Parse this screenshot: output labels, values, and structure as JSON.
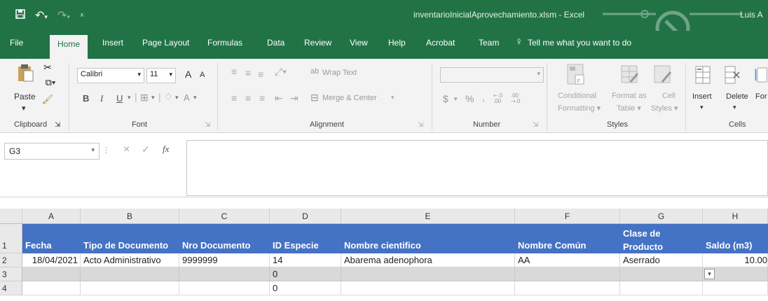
{
  "window": {
    "title": "inventarioInicialAprovechamiento.xlsm  -  Excel",
    "user": "Luis A"
  },
  "tabs": [
    {
      "label": "File"
    },
    {
      "label": "Home"
    },
    {
      "label": "Insert"
    },
    {
      "label": "Page Layout"
    },
    {
      "label": "Formulas"
    },
    {
      "label": "Data"
    },
    {
      "label": "Review"
    },
    {
      "label": "View"
    },
    {
      "label": "Help"
    },
    {
      "label": "Acrobat"
    },
    {
      "label": "Team"
    }
  ],
  "tell_me": "Tell me what you want to do",
  "ribbon": {
    "clipboard": {
      "paste": "Paste",
      "label": "Clipboard"
    },
    "font": {
      "name": "Calibri",
      "size": "11",
      "bold": "B",
      "italic": "I",
      "underline": "U",
      "grow": "A",
      "shrink": "A",
      "color": "A",
      "label": "Font"
    },
    "alignment": {
      "wrap": "Wrap Text",
      "merge": "Merge & Center",
      "label": "Alignment"
    },
    "number": {
      "currency": "$",
      "percent": "%",
      "comma": ",",
      "inc": ".00",
      "dec": ".00",
      "label": "Number"
    },
    "styles": {
      "conditional": "Conditional",
      "conditional2": "Formatting",
      "format_as": "Format as",
      "format_as2": "Table",
      "cell": "Cell",
      "cell2": "Styles",
      "label": "Styles"
    },
    "cells": {
      "insert": "Insert",
      "delete": "Delete",
      "format": "For",
      "label": "Cells"
    }
  },
  "formula_bar": {
    "name_box": "G3",
    "fx": "fx",
    "formula": ""
  },
  "sheet": {
    "columns": [
      "A",
      "B",
      "C",
      "D",
      "E",
      "F",
      "G",
      "H"
    ],
    "rows": [
      "1",
      "2",
      "3",
      "4"
    ],
    "header": {
      "a": "Fecha",
      "b": "Tipo de Documento",
      "c": "Nro Documento",
      "d": "ID Especie",
      "e": "Nombre cientifico",
      "f": "Nombre Común",
      "g1": "Clase de",
      "g2": "Producto",
      "h": "Saldo (m3)"
    },
    "row2": {
      "a": "18/04/2021",
      "b": "Acto Administrativo",
      "c": "9999999",
      "d": "14",
      "e": "Abarema adenophora",
      "f": "AA",
      "g": "Aserrado",
      "h": "10.00"
    },
    "row3": {
      "d": "0"
    },
    "row4": {
      "d": "0"
    }
  },
  "colors": {
    "excel_green": "#217346",
    "table_header": "#4472c4",
    "selected_row": "#d9d9d9"
  }
}
